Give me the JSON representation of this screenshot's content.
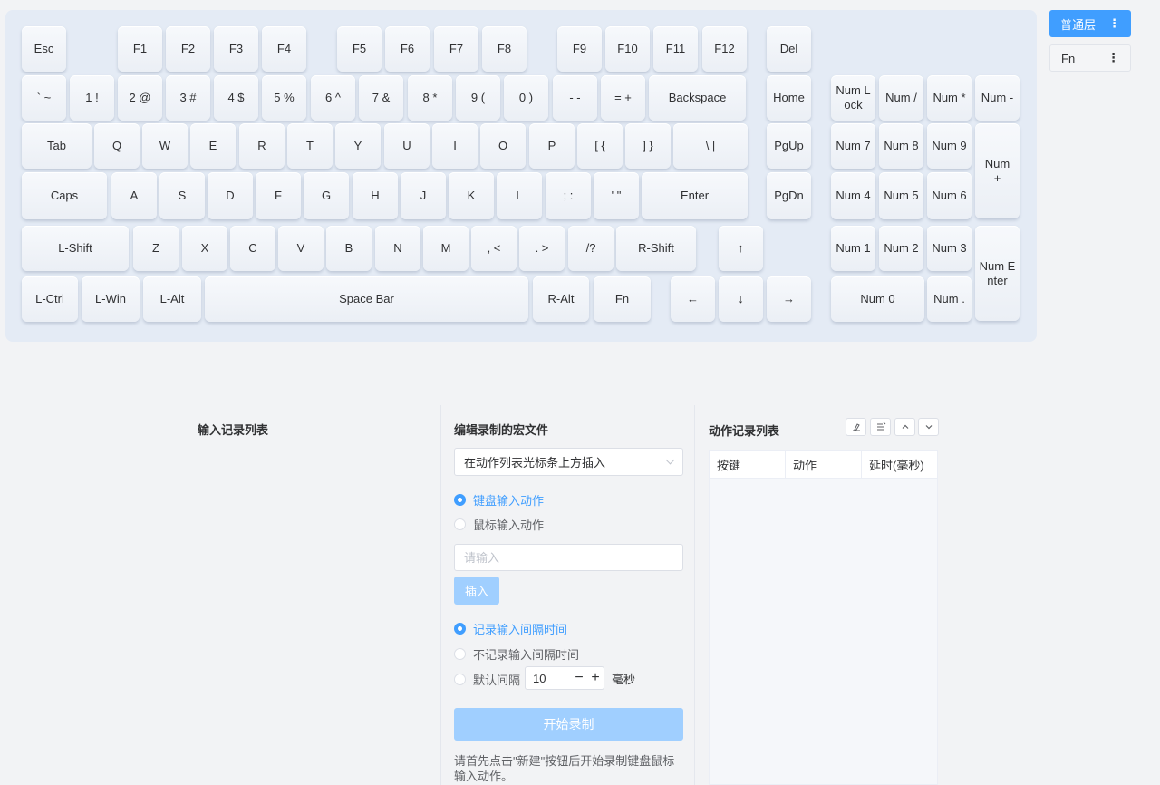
{
  "keyboard": {
    "keys": [
      {
        "label": "Esc"
      },
      {
        "label": "F1"
      },
      {
        "label": "F2"
      },
      {
        "label": "F3"
      },
      {
        "label": "F4"
      },
      {
        "label": "F5"
      },
      {
        "label": "F6"
      },
      {
        "label": "F7"
      },
      {
        "label": "F8"
      },
      {
        "label": "F9"
      },
      {
        "label": "F10"
      },
      {
        "label": "F11"
      },
      {
        "label": "F12"
      },
      {
        "label": "Del"
      },
      {
        "label": "` ~"
      },
      {
        "label": "1 !"
      },
      {
        "label": "2 @"
      },
      {
        "label": "3 #"
      },
      {
        "label": "4 $"
      },
      {
        "label": "5 %"
      },
      {
        "label": "6 ^"
      },
      {
        "label": "7 &"
      },
      {
        "label": "8 *"
      },
      {
        "label": "9 ("
      },
      {
        "label": "0 )"
      },
      {
        "label": "- -"
      },
      {
        "label": "= +"
      },
      {
        "label": "Backspace"
      },
      {
        "label": "Home"
      },
      {
        "label": "Num L\nock"
      },
      {
        "label": "Num /"
      },
      {
        "label": "Num *"
      },
      {
        "label": "Num -"
      },
      {
        "label": "Tab"
      },
      {
        "label": "Q"
      },
      {
        "label": "W"
      },
      {
        "label": "E"
      },
      {
        "label": "R"
      },
      {
        "label": "T"
      },
      {
        "label": "Y"
      },
      {
        "label": "U"
      },
      {
        "label": "I"
      },
      {
        "label": "O"
      },
      {
        "label": "P"
      },
      {
        "label": "[ {"
      },
      {
        "label": "] }"
      },
      {
        "label": "\\ |"
      },
      {
        "label": "PgUp"
      },
      {
        "label": "Num 7"
      },
      {
        "label": "Num 8"
      },
      {
        "label": "Num 9"
      },
      {
        "label": "Num\n+"
      },
      {
        "label": "Caps"
      },
      {
        "label": "A"
      },
      {
        "label": "S"
      },
      {
        "label": "D"
      },
      {
        "label": "F"
      },
      {
        "label": "G"
      },
      {
        "label": "H"
      },
      {
        "label": "J"
      },
      {
        "label": "K"
      },
      {
        "label": "L"
      },
      {
        "label": "; :"
      },
      {
        "label": "' \""
      },
      {
        "label": "Enter"
      },
      {
        "label": "PgDn"
      },
      {
        "label": "Num 4"
      },
      {
        "label": "Num 5"
      },
      {
        "label": "Num 6"
      },
      {
        "label": "L-Shift"
      },
      {
        "label": "Z"
      },
      {
        "label": "X"
      },
      {
        "label": "C"
      },
      {
        "label": "V"
      },
      {
        "label": "B"
      },
      {
        "label": "N"
      },
      {
        "label": "M"
      },
      {
        "label": ", <"
      },
      {
        "label": ". >"
      },
      {
        "label": "/?"
      },
      {
        "label": "R-Shift"
      },
      {
        "label": "↑"
      },
      {
        "label": "Num 1"
      },
      {
        "label": "Num 2"
      },
      {
        "label": "Num 3"
      },
      {
        "label": "Num E\nnter"
      },
      {
        "label": "L-Ctrl"
      },
      {
        "label": "L-Win"
      },
      {
        "label": "L-Alt"
      },
      {
        "label": "Space Bar"
      },
      {
        "label": "R-Alt"
      },
      {
        "label": "Fn"
      },
      {
        "label": "←"
      },
      {
        "label": "↓"
      },
      {
        "label": "→"
      },
      {
        "label": "Num 0"
      },
      {
        "label": "Num ."
      }
    ]
  },
  "layers": {
    "normal": {
      "label": "普通层",
      "menu": "⋮"
    },
    "fn": {
      "label": "Fn",
      "menu": "⋮"
    }
  },
  "input_list": {
    "title": "输入记录列表"
  },
  "editor": {
    "title": "编辑录制的宏文件",
    "insert_mode": "在动作列表光标条上方插入",
    "action_type": {
      "keyboard": "键盘输入动作",
      "mouse": "鼠标输入动作",
      "selected": "keyboard"
    },
    "input_placeholder": "请输入",
    "insert_button": "插入",
    "interval": {
      "record": "记录输入间隔时间",
      "no_record": "不记录输入间隔时间",
      "default": "默认间隔",
      "selected": "record"
    },
    "default_interval_value": "10",
    "minus": "−",
    "plus": "+",
    "unit": "毫秒",
    "start_button": "开始录制",
    "hint": "请首先点击\"新建\"按钮后开始录制键盘鼠标输入动作。"
  },
  "action_list": {
    "title": "动作记录列表",
    "tool_icons": [
      "clear-icon",
      "edit-list-icon",
      "move-up-icon",
      "move-down-icon"
    ],
    "columns": [
      "按键",
      "动作",
      "延时(毫秒)"
    ],
    "rows": []
  }
}
